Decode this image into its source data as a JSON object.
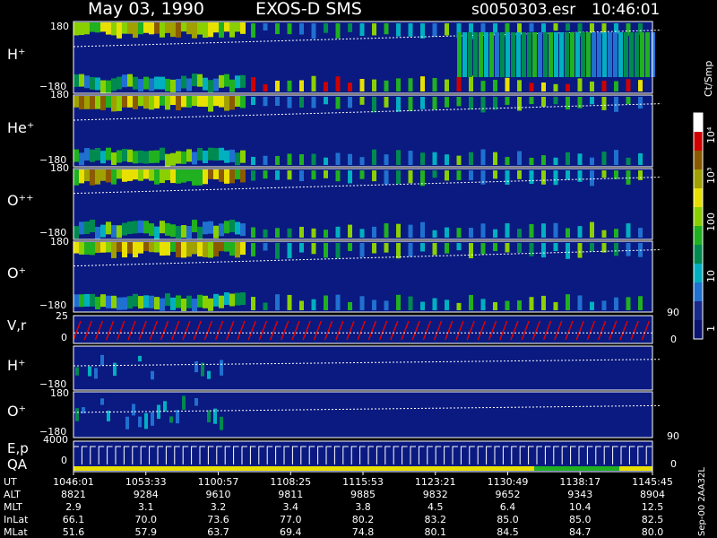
{
  "header": {
    "date": "May 03, 1990",
    "mission": "EXOS-D SMS",
    "file": "s0050303.esr",
    "time": "10:46:01"
  },
  "colorbar": {
    "unit": "Ct/Smp",
    "tick_labels": [
      "10⁴",
      "10³",
      "100",
      "10",
      "1"
    ],
    "colors": [
      "#ffffff",
      "#d00000",
      "#8b5a00",
      "#a0a000",
      "#e8e000",
      "#8ad000",
      "#20b020",
      "#008a50",
      "#00b0c0",
      "#2070d0",
      "#1a2a8a",
      "#0a1470"
    ]
  },
  "panels": [
    {
      "label": "H⁺",
      "ymax": "180",
      "ymin": "−180"
    },
    {
      "label": "He⁺",
      "ymax": "180",
      "ymin": "−180"
    },
    {
      "label": "O⁺⁺",
      "ymax": "180",
      "ymin": "−180"
    },
    {
      "label": "O⁺",
      "ymax": "180",
      "ymin": "−180",
      "right_tick": "90"
    },
    {
      "label": "V,r",
      "ymax": "25",
      "ymin": "0",
      "right_tick": "0"
    },
    {
      "label": "H⁺",
      "ymax": "",
      "ymin": "−180"
    },
    {
      "label": "O⁺",
      "ymax": "180",
      "ymin": "−180",
      "right_tick": "90"
    },
    {
      "label": "E,p",
      "label2": "QA",
      "ymax": "4000",
      "ymin": "0",
      "right_tick": "0"
    }
  ],
  "ephemeris": {
    "row_labels": [
      "UT",
      "ALT",
      "MLT",
      "InLat",
      "MLat"
    ],
    "columns": [
      [
        "1046:01",
        "8821",
        "2.9",
        "66.1",
        "51.6"
      ],
      [
        "1053:33",
        "9284",
        "3.1",
        "70.0",
        "57.9"
      ],
      [
        "1100:57",
        "9610",
        "3.2",
        "73.6",
        "63.7"
      ],
      [
        "1108:25",
        "9811",
        "3.4",
        "77.0",
        "69.4"
      ],
      [
        "1115:53",
        "9885",
        "3.8",
        "80.2",
        "74.8"
      ],
      [
        "1123:21",
        "9832",
        "4.5",
        "83.2",
        "80.1"
      ],
      [
        "1130:49",
        "9652",
        "6.4",
        "85.0",
        "84.5"
      ],
      [
        "1138:17",
        "9343",
        "10.4",
        "85.0",
        "84.7"
      ],
      [
        "1145:45",
        "8904",
        "12.5",
        "82.5",
        "80.0"
      ]
    ]
  },
  "side_note": "Sep-00  2AA32L",
  "chart_data": {
    "type": "heatmap",
    "title": "May 03, 1990   EXOS-D SMS",
    "x_ticks": [
      "1046:01",
      "1053:33",
      "1100:57",
      "1108:25",
      "1115:53",
      "1123:21",
      "1130:49",
      "1138:17",
      "1145:45"
    ],
    "colorbar_scale": "log",
    "colorbar_range": [
      1,
      10000
    ],
    "series": [
      {
        "name": "H⁺",
        "ylim": [
          -180,
          180
        ]
      },
      {
        "name": "He⁺",
        "ylim": [
          -180,
          180
        ]
      },
      {
        "name": "O⁺⁺",
        "ylim": [
          -180,
          180
        ]
      },
      {
        "name": "O⁺",
        "ylim": [
          -180,
          180
        ]
      },
      {
        "name": "V,r",
        "ylim": [
          0,
          25
        ]
      },
      {
        "name": "H⁺",
        "ylim": [
          -180,
          180
        ]
      },
      {
        "name": "O⁺",
        "ylim": [
          -180,
          180
        ]
      },
      {
        "name": "E,p",
        "ylim": [
          0,
          4000
        ]
      }
    ]
  }
}
